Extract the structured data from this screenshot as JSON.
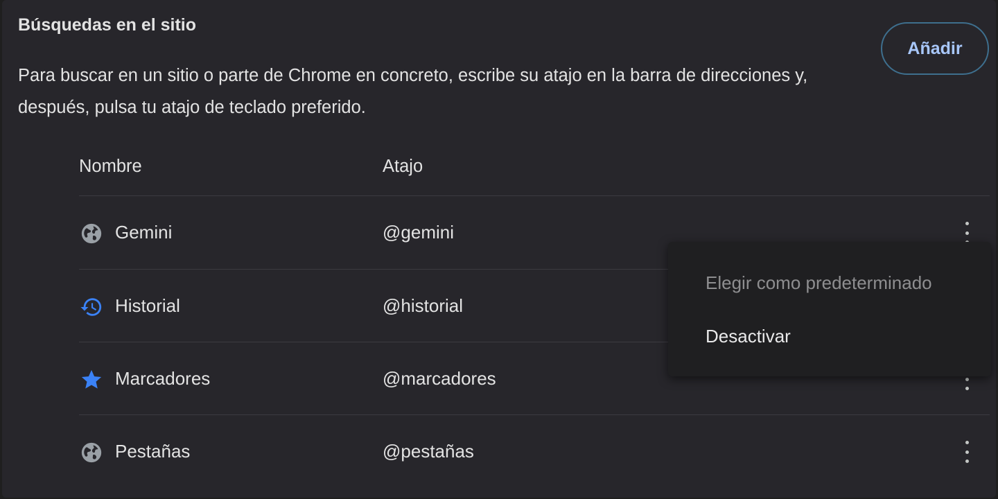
{
  "section": {
    "title": "Búsquedas en el sitio",
    "description": "Para buscar en un sitio o parte de Chrome en concreto, escribe su atajo en la barra de direcciones y, después, pulsa tu atajo de teclado preferido.",
    "add_button": "Añadir"
  },
  "table": {
    "columns": {
      "name": "Nombre",
      "shortcut": "Atajo"
    },
    "rows": [
      {
        "name": "Gemini",
        "shortcut": "@gemini",
        "icon": "globe-icon"
      },
      {
        "name": "Historial",
        "shortcut": "@historial",
        "icon": "history-icon"
      },
      {
        "name": "Marcadores",
        "shortcut": "@marcadores",
        "icon": "star-icon"
      },
      {
        "name": "Pestañas",
        "shortcut": "@pestañas",
        "icon": "globe-icon"
      }
    ]
  },
  "context_menu": {
    "items": [
      {
        "label": "Elegir como predeterminado",
        "enabled": false
      },
      {
        "label": "Desactivar",
        "enabled": true
      }
    ]
  },
  "colors": {
    "background": "#27262b",
    "accent": "#a8c7fa",
    "icon_blue": "#3b82f6",
    "icon_gray": "#9aa0a6"
  }
}
